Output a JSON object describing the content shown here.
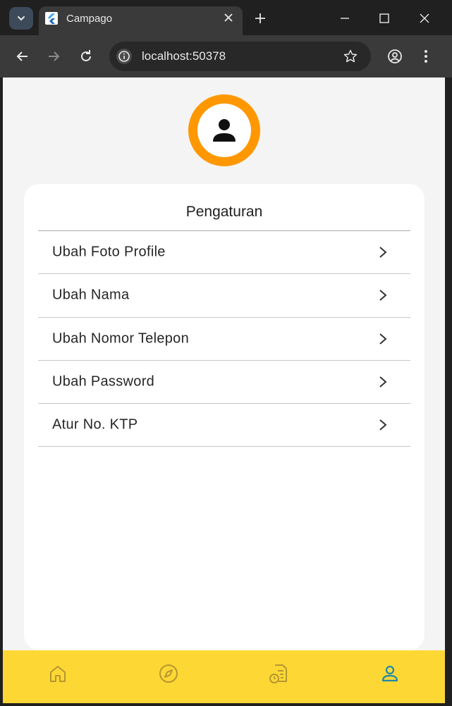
{
  "browser": {
    "tab_title": "Campago",
    "url": "localhost:50378"
  },
  "page": {
    "card_title": "Pengaturan",
    "menu": [
      {
        "label": "Ubah Foto Profile"
      },
      {
        "label": "Ubah Nama"
      },
      {
        "label": "Ubah Nomor Telepon"
      },
      {
        "label": "Ubah Password"
      },
      {
        "label": "Atur No. KTP"
      }
    ]
  },
  "bottom_nav": {
    "items": [
      {
        "icon": "home-icon",
        "active": false
      },
      {
        "icon": "compass-icon",
        "active": false
      },
      {
        "icon": "history-document-icon",
        "active": false
      },
      {
        "icon": "person-icon",
        "active": true
      }
    ]
  },
  "colors": {
    "accent_orange": "#ff9800",
    "nav_yellow": "#fdd835",
    "active_teal": "#1e88a8",
    "inactive_icon": "#b5962f"
  }
}
